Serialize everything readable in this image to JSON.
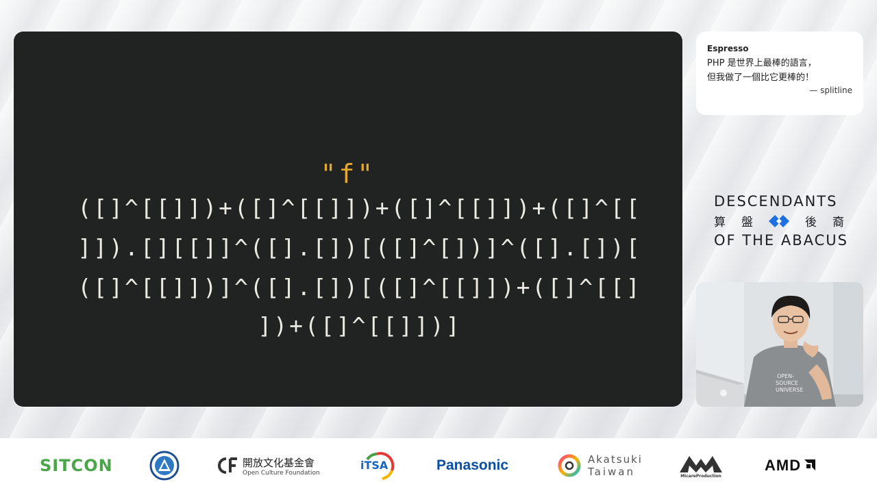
{
  "slide": {
    "title": "\"f\"",
    "code_lines": [
      "([]^[[]])+([]^[[]])+([]^[[]])+([]^[[",
      "]]).[][[]]^([].[])[([]^[])]^([].[])[",
      "([]^[[]])]^([].[])[([]^[[]])+([]^[[]",
      "])+([]^[[]])]"
    ]
  },
  "quote": {
    "author": "Espresso",
    "line1": "PHP 是世界上最棒的語言，",
    "line2": "但我做了一個比它更棒的！",
    "signature": "— splitline"
  },
  "brand": {
    "line1": "DESCENDANTS",
    "chars": [
      "算",
      "盤",
      "後",
      "裔"
    ],
    "line3": "OF THE ABACUS"
  },
  "webcam": {
    "shirt_text": [
      "OPEN-",
      "SOURCE",
      "UNIVERSE"
    ]
  },
  "sponsors": {
    "sitcon": "SITCON",
    "ocf_cn": "開放文化基金會",
    "ocf_en": "Open Culture Foundation",
    "itsa": "iTSA",
    "panasonic": "Panasonic",
    "akatsuki_1": "Akatsuki",
    "akatsuki_2": "Taiwan",
    "micare": "MicareProduction",
    "amd": "AMD"
  },
  "colors": {
    "slide_bg": "#202321",
    "title_accent": "#e6a92c",
    "code_text": "#eceae4",
    "brand_blue": "#1e6fe0",
    "sitcon_green": "#4aa648",
    "panasonic_blue": "#0a4ea3"
  }
}
